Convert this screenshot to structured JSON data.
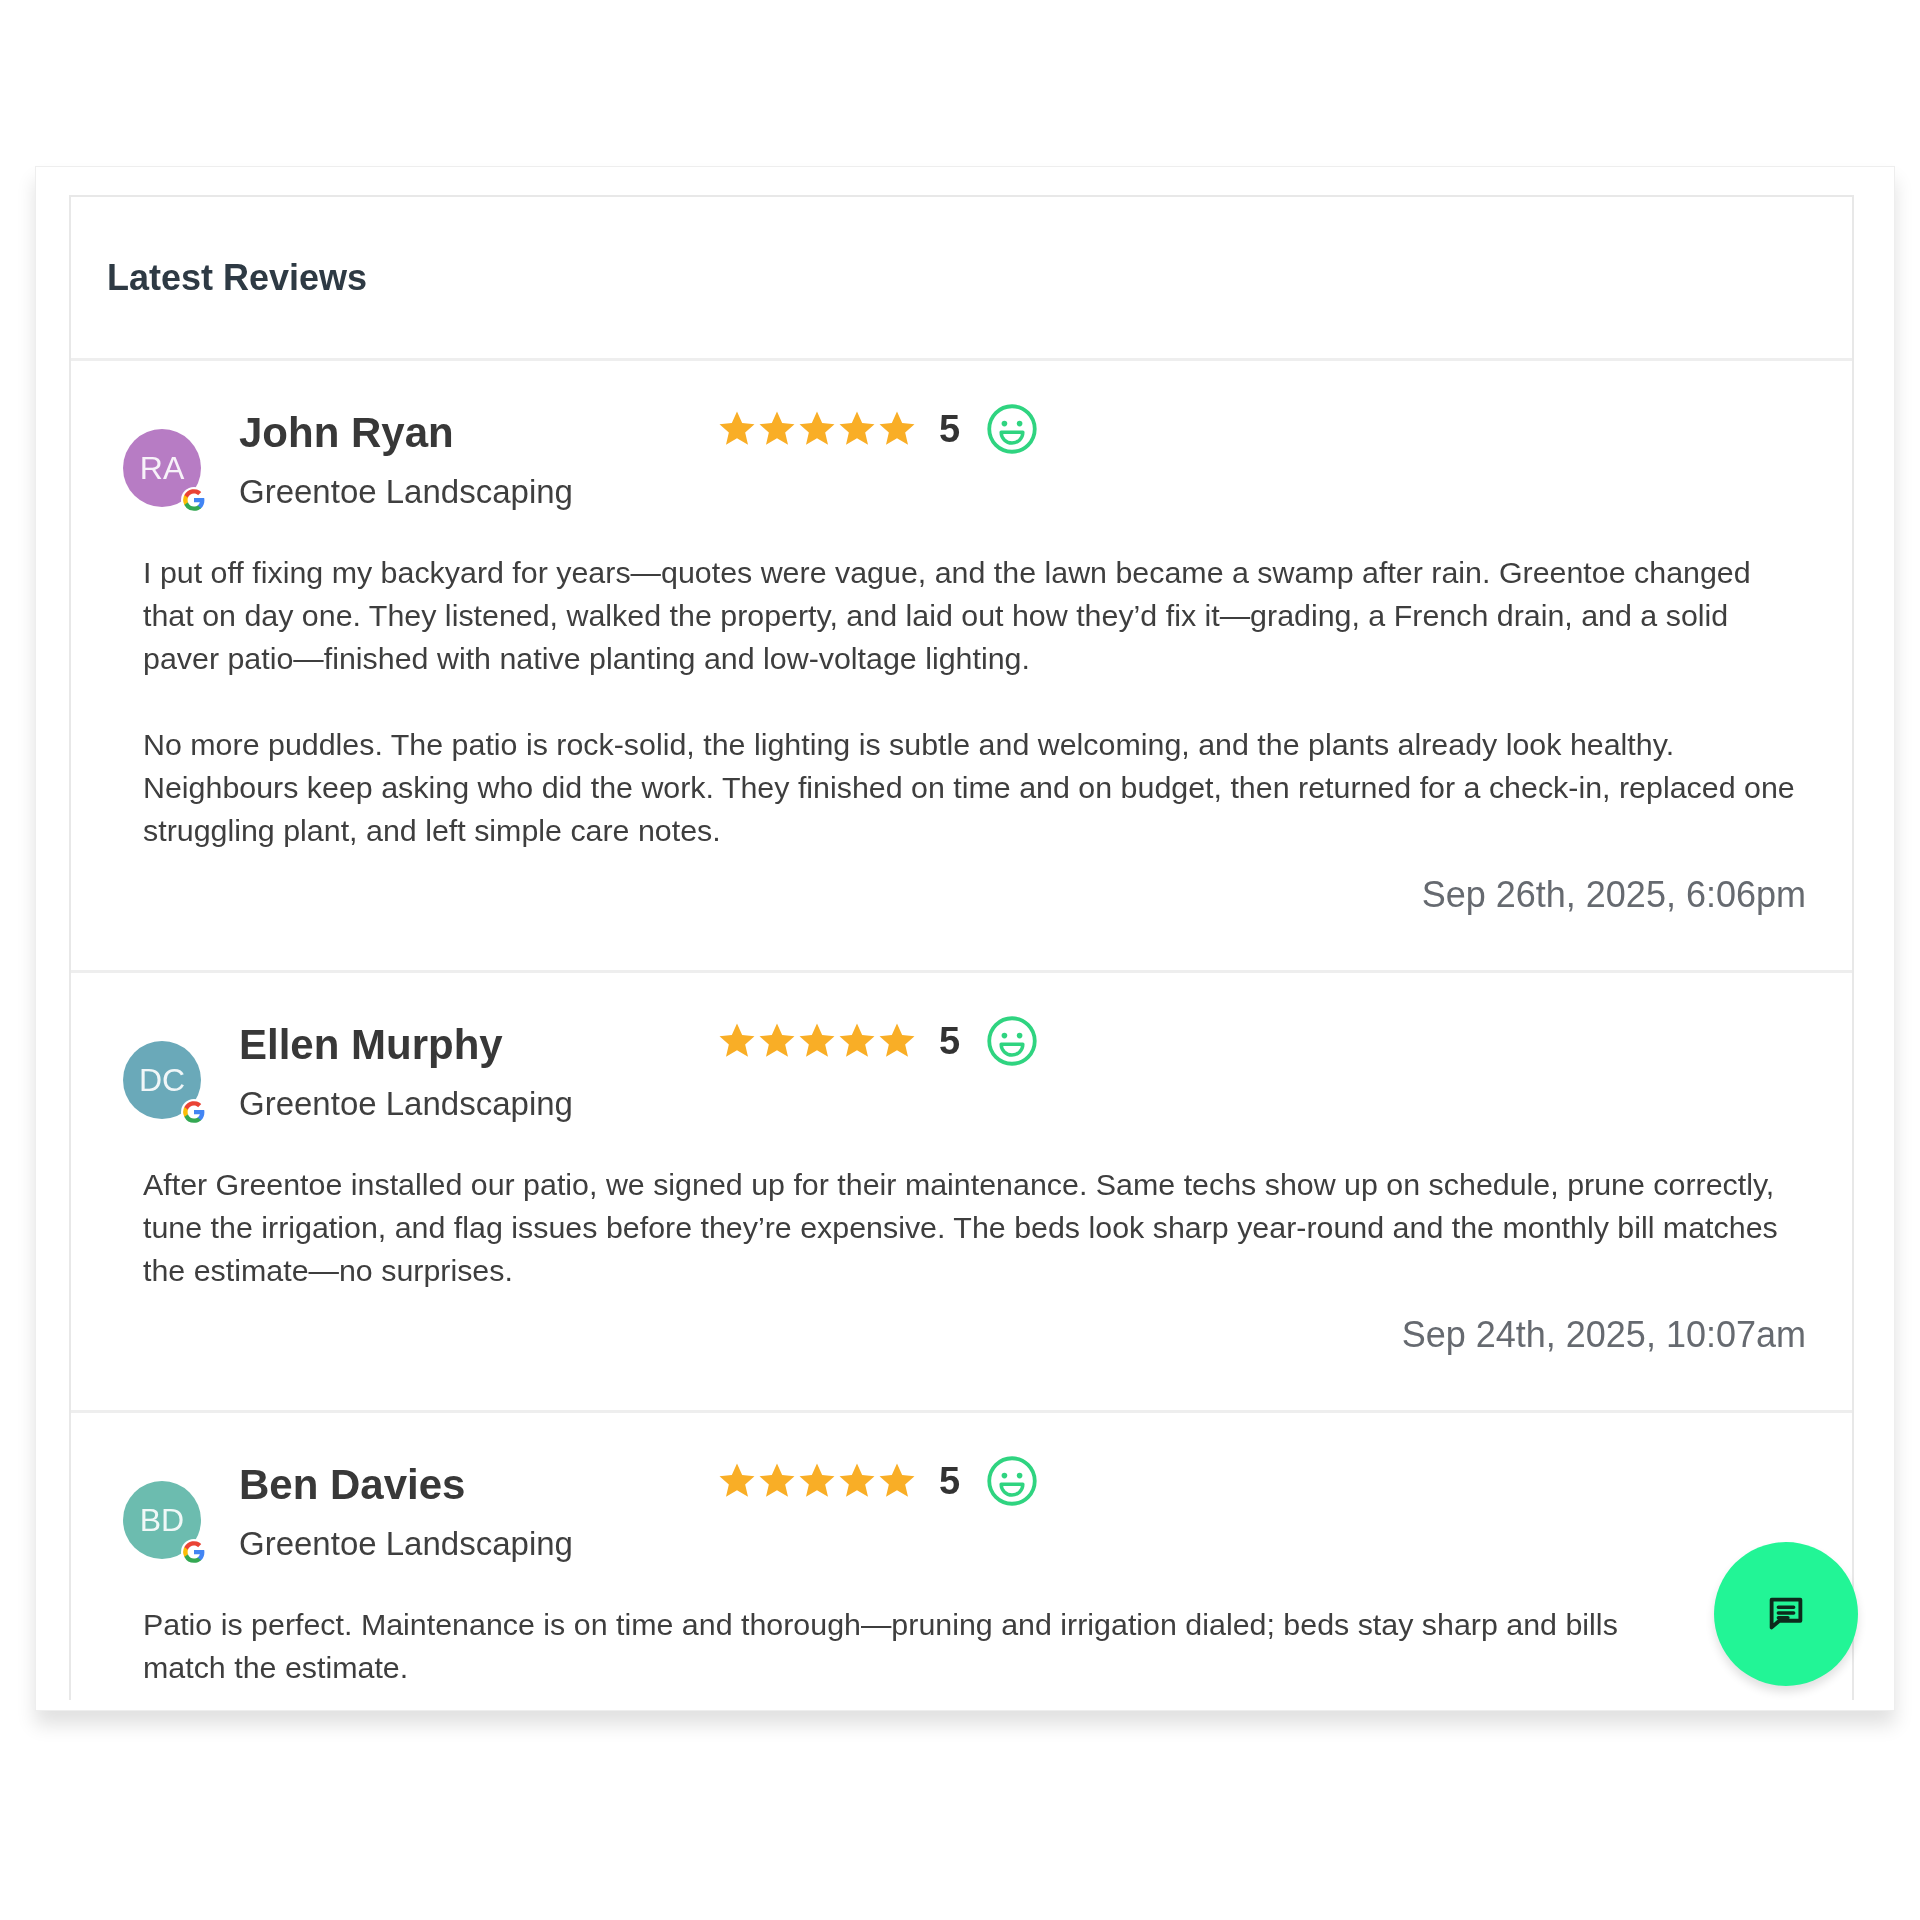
{
  "title": "Latest Reviews",
  "reviews": [
    {
      "avatar": {
        "initials": "RA",
        "color": "#b77cc4"
      },
      "name": "John Ryan",
      "business": "Greentoe Landscaping",
      "stars": 5,
      "score": "5",
      "paragraphs": [
        "I put off fixing my backyard for years—quotes were vague, and the lawn became a swamp after rain. Greentoe changed that on day one. They listened, walked the property, and laid out how they’d fix it—grading, a French drain, and a solid paver patio—finished with native planting and low-voltage lighting.",
        "No more puddles. The patio is rock-solid, the lighting is subtle and welcoming, and the plants already look healthy. Neighbours keep asking who did the work. They finished on time and on budget, then returned for a check-in, replaced one struggling plant, and left simple care notes."
      ],
      "date": "Sep 26th, 2025, 6:06pm"
    },
    {
      "avatar": {
        "initials": "DC",
        "color": "#6aa9b9"
      },
      "name": "Ellen Murphy",
      "business": "Greentoe Landscaping",
      "stars": 5,
      "score": "5",
      "paragraphs": [
        "After Greentoe installed our patio, we signed up for their maintenance. Same techs show up on schedule, prune correctly, tune the irrigation, and flag issues before they’re expensive. The beds look sharp year-round and the monthly bill matches the estimate—no surprises."
      ],
      "date": "Sep 24th, 2025, 10:07am"
    },
    {
      "avatar": {
        "initials": "BD",
        "color": "#6cbcaf"
      },
      "name": "Ben Davies",
      "business": "Greentoe Landscaping",
      "stars": 5,
      "score": "5",
      "paragraphs": [
        "Patio is perfect. Maintenance is on time and thorough—pruning and irrigation dialed; beds stay sharp and bills match the estimate."
      ]
    }
  ]
}
